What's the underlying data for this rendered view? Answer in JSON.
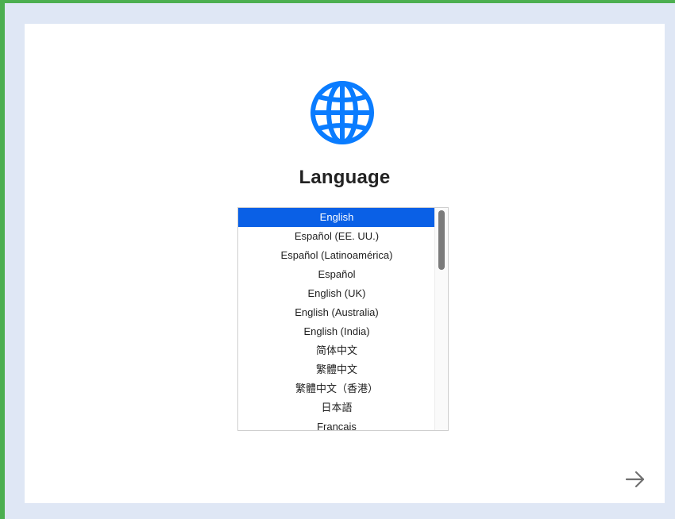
{
  "setup": {
    "title": "Language",
    "languages": [
      "English",
      "Español (EE. UU.)",
      "Español (Latinoamérica)",
      "Español",
      "English (UK)",
      "English (Australia)",
      "English (India)",
      "简体中文",
      "繁體中文",
      "繁體中文（香港）",
      "日本語",
      "Français"
    ],
    "selected_index": 0,
    "colors": {
      "accent": "#0a60e6",
      "globe": "#0a7cff",
      "frame": "#4caf50",
      "background": "#dfe7f5"
    },
    "icons": {
      "globe": "globe-icon",
      "next": "right-arrow-icon"
    }
  }
}
